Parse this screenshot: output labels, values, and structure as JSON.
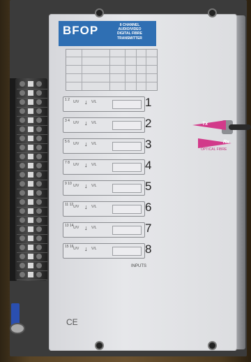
{
  "device": {
    "brand": "BFOP",
    "subtitle_lines": [
      "8 CHANNEL",
      "AUDIO/VIDEO",
      "DIGITAL FIBRE",
      "TRANSMITTER"
    ],
    "optical_label": "OPTICAL FIBRE",
    "tx_label": "Tx",
    "rx_label": "Rx",
    "inputs_label": "INPUTS",
    "ce_mark": "CE"
  },
  "channels": [
    {
      "num": "1",
      "pins": "1 2",
      "a": "U/V",
      "b": "V/L"
    },
    {
      "num": "2",
      "pins": "3 4",
      "a": "U/V",
      "b": "V/L"
    },
    {
      "num": "3",
      "pins": "5 6",
      "a": "U/V",
      "b": "V/L"
    },
    {
      "num": "4",
      "pins": "7 8",
      "a": "U/V",
      "b": "V/L"
    },
    {
      "num": "5",
      "pins": "9 10",
      "a": "U/V",
      "b": "V/L"
    },
    {
      "num": "6",
      "pins": "11 12",
      "a": "U/V",
      "b": "V/L"
    },
    {
      "num": "7",
      "pins": "13 14",
      "a": "U/V",
      "b": "V/L"
    },
    {
      "num": "8",
      "pins": "15 16",
      "a": "U/V",
      "b": "V/L"
    }
  ],
  "colors": {
    "header": "#2f6fb3",
    "fibre_arrow": "#d23a8a",
    "enclosure": "#e2e3e6"
  }
}
